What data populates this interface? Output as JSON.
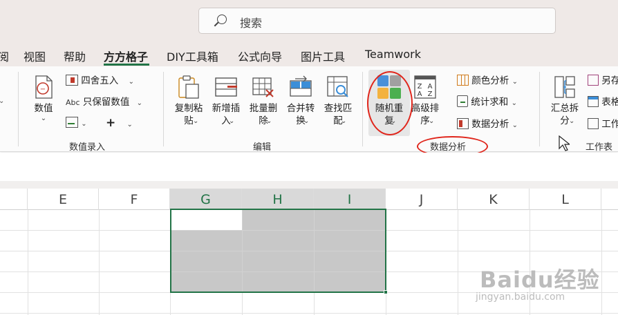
{
  "search": {
    "placeholder": "搜索"
  },
  "tabs": [
    {
      "label": "阅"
    },
    {
      "label": "视图"
    },
    {
      "label": "帮助"
    },
    {
      "label": "方方格子",
      "active": true
    },
    {
      "label": "DIY工具箱"
    },
    {
      "label": "公式向导"
    },
    {
      "label": "图片工具"
    },
    {
      "label": "Teamwork"
    }
  ],
  "ribbon": {
    "group_numeric": {
      "label": "数值录入",
      "numeric_button": "数值",
      "round": "四舍五入",
      "keep_values": "只保留数值",
      "abc": "Abc",
      "plus": "+"
    },
    "group_edit": {
      "label": "编辑",
      "copy_paste": "复制粘\n贴",
      "add_insert": "新增插\n入",
      "batch_delete": "批量删\n除",
      "merge_convert": "合并转\n换",
      "find_match": "查找匹\n配"
    },
    "group_data": {
      "label": "数据分析",
      "random_repeat": "随机重\n复",
      "advanced_sort": "高级排\n序",
      "color_analysis": "颜色分析",
      "stat_sum": "统计求和",
      "data_analysis": "数据分析"
    },
    "group_sheet": {
      "label": "工作表",
      "summary_split": "汇总拆\n分",
      "save_as": "另存",
      "table": "表格",
      "work": "工作"
    }
  },
  "columns": [
    "E",
    "F",
    "G",
    "H",
    "I",
    "J",
    "K",
    "L"
  ],
  "watermark": {
    "brand": "Baidu经验",
    "url": "jingyan.baidu.com"
  },
  "colors": {
    "accent": "#217346",
    "annotation": "#e0251b",
    "selection": "#c8c8c8"
  }
}
